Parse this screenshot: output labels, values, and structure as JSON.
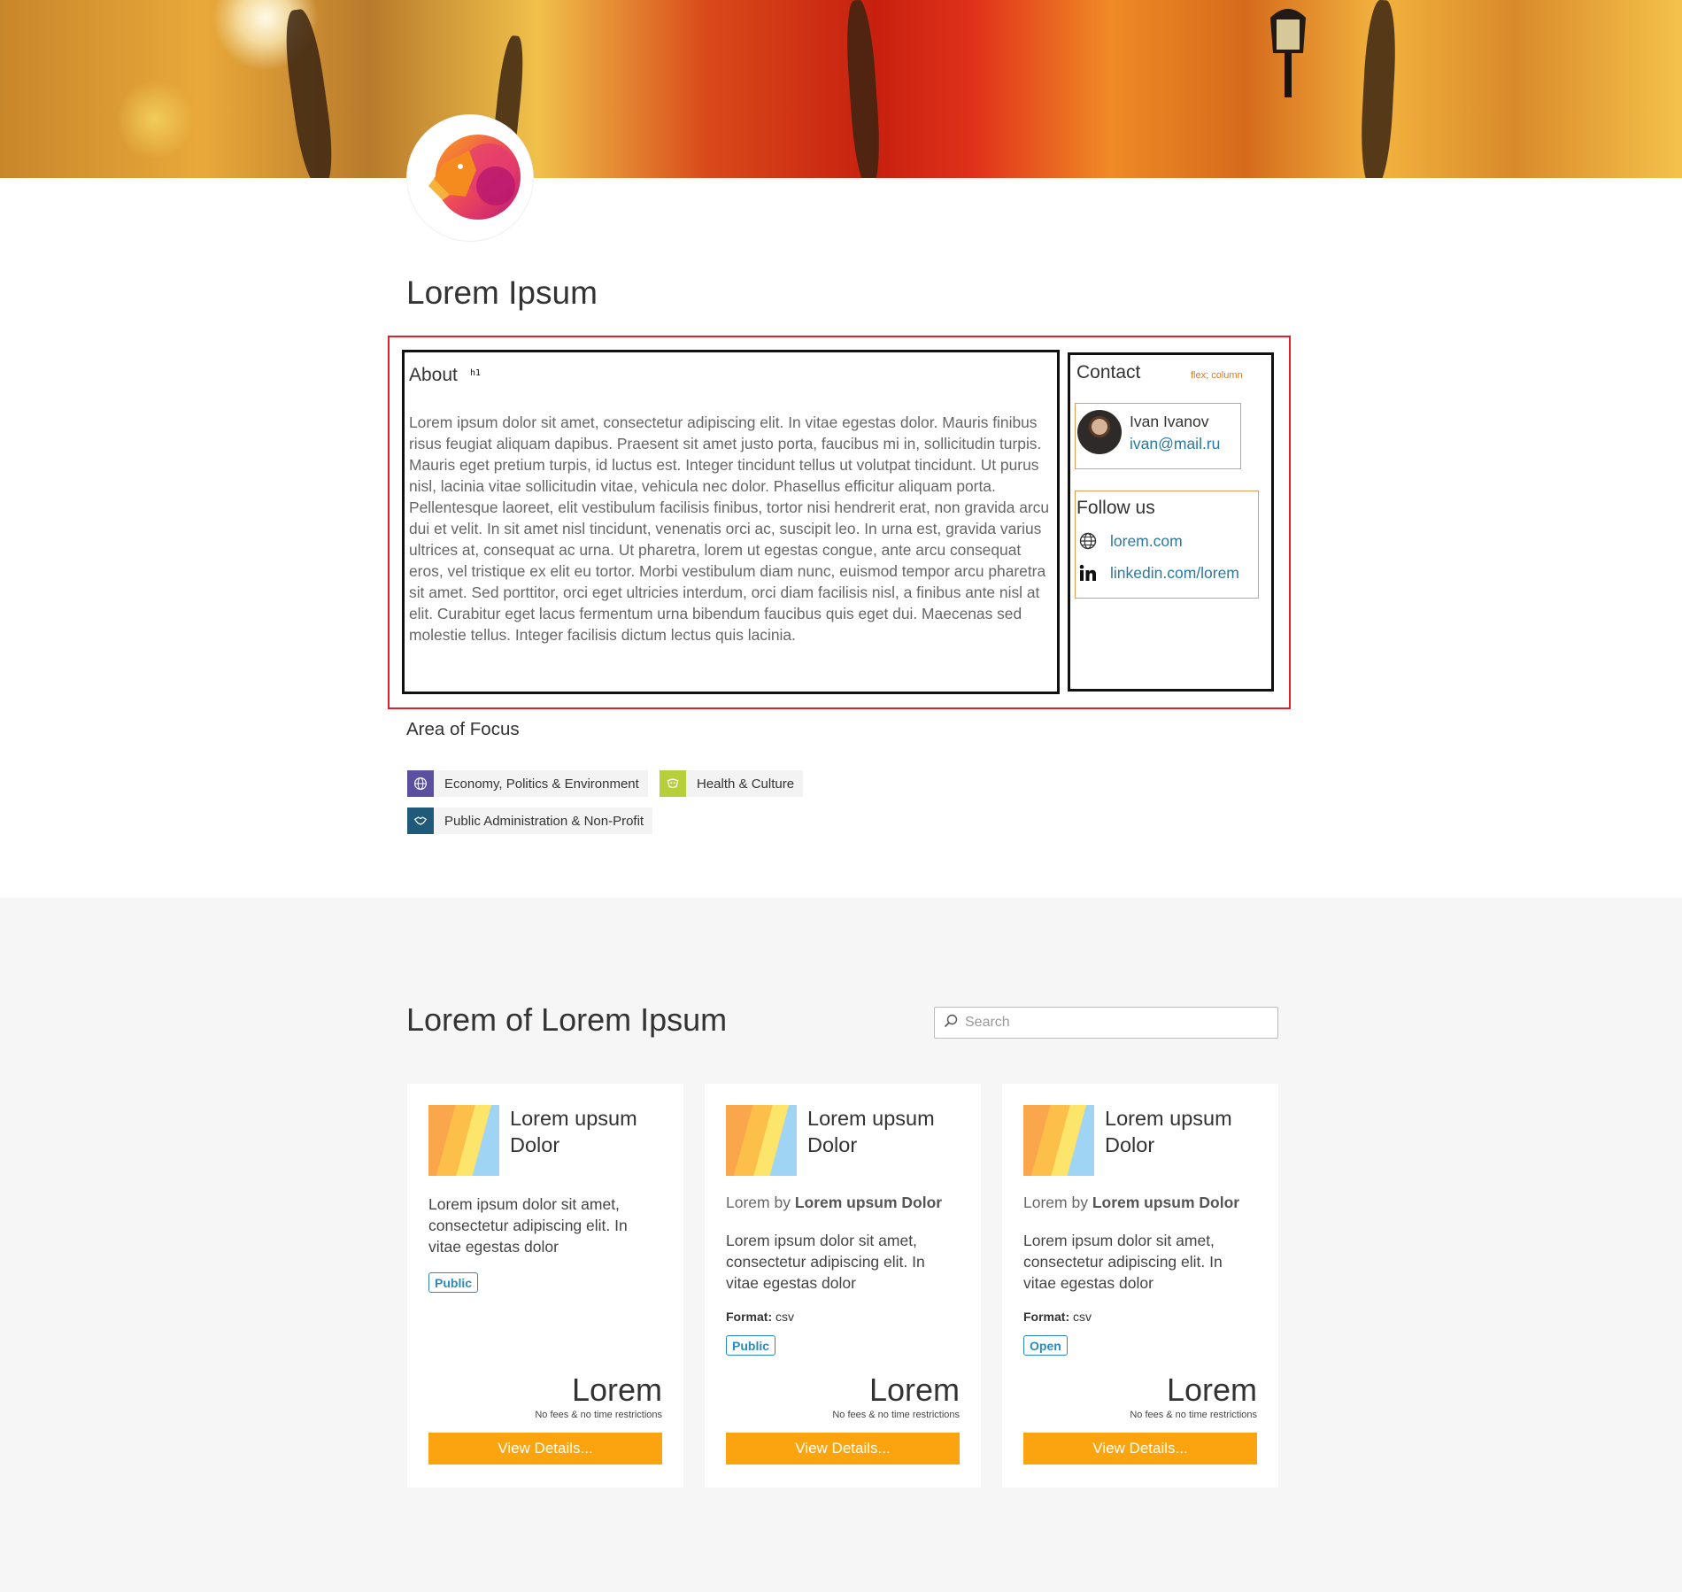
{
  "hero": {
    "banner_icon": "autumn-forest-banner-image",
    "logo_icon": "lion-logo-icon"
  },
  "page_title": "Lorem Ipsum",
  "about": {
    "title": "About",
    "tag_note": "h1",
    "text": "Lorem ipsum dolor sit amet, consectetur adipiscing elit. In vitae egestas dolor. Mauris finibus risus feugiat aliquam dapibus. Praesent sit amet justo porta, faucibus mi in, sollicitudin turpis. Mauris eget pretium turpis, id luctus est. Integer tincidunt tellus ut volutpat tincidunt. Ut purus nisl, lacinia vitae sollicitudin vitae, vehicula nec dolor. Phasellus efficitur aliquam porta. Pellentesque laoreet, elit vestibulum facilisis finibus, tortor nisi hendrerit erat, non gravida arcu dui et velit. In sit amet nisl tincidunt, venenatis orci ac, suscipit leo. In urna est, gravida varius ultrices at, consequat ac urna. Ut pharetra, lorem ut egestas congue, ante arcu consequat eros, vel tristique ex elit eu tortor. Morbi vestibulum diam nunc, euismod tempor arcu pharetra sit amet. Sed porttitor, orci eget ultricies interdum, orci diam facilisis nisl, a finibus ante nisl at elit. Curabitur eget lacus fermentum urna bibendum faucibus quis eget dui. Maecenas sed molestie tellus. Integer facilisis dictum lectus quis lacinia."
  },
  "contact": {
    "title": "Contact",
    "layout_note": "flex; column",
    "person": {
      "name": "Ivan Ivanov",
      "email": "ivan@mail.ru"
    },
    "follow": {
      "title": "Follow us",
      "links": [
        {
          "icon": "globe-icon",
          "label": "lorem.com"
        },
        {
          "icon": "linkedin-icon",
          "label": "linkedin.com/lorem"
        }
      ]
    }
  },
  "focus": {
    "title": "Area of Focus",
    "tags": [
      {
        "label": "Economy, Politics & Environment",
        "icon": "globe-icon",
        "color": "#5b4fa0"
      },
      {
        "label": "Health & Culture",
        "icon": "culture-icon",
        "color": "#b7cf3a"
      },
      {
        "label": "Public Administration & Non-Profit",
        "icon": "handshake-icon",
        "color": "#1f5a7a"
      }
    ]
  },
  "datasets": {
    "title": "Lorem of Lorem Ipsum",
    "search_placeholder": "Search",
    "cards": [
      {
        "title": "Lorem upsum Dolor",
        "description": "Lorem ipsum dolor sit amet, consectetur adipiscing elit. In vitae egestas dolor",
        "badge": "Public",
        "price": "Lorem",
        "price_note": "No fees & no time restrictions",
        "button": "View Details..."
      },
      {
        "title": "Lorem upsum Dolor",
        "by_prefix": "Lorem by ",
        "by_name": "Lorem upsum Dolor",
        "description": "Lorem ipsum dolor sit amet, consectetur adipiscing elit. In vitae egestas dolor",
        "format_label": "Format:",
        "format_value": "csv",
        "badge": "Public",
        "price": "Lorem",
        "price_note": "No fees & no time restrictions",
        "button": "View Details..."
      },
      {
        "title": "Lorem upsum Dolor",
        "by_prefix": "Lorem by ",
        "by_name": "Lorem upsum Dolor",
        "description": "Lorem ipsum dolor sit amet, consectetur adipiscing elit. In vitae egestas dolor",
        "format_label": "Format:",
        "format_value": "csv",
        "badge": "Open",
        "price": "Lorem",
        "price_note": "No fees & no time restrictions",
        "button": "View Details..."
      }
    ]
  },
  "colors": {
    "accent_button": "#fca410",
    "link": "#2a78a0",
    "badge": "#2a8abf",
    "outline_red": "#e0202a",
    "outline_orange": "#e89a50"
  }
}
